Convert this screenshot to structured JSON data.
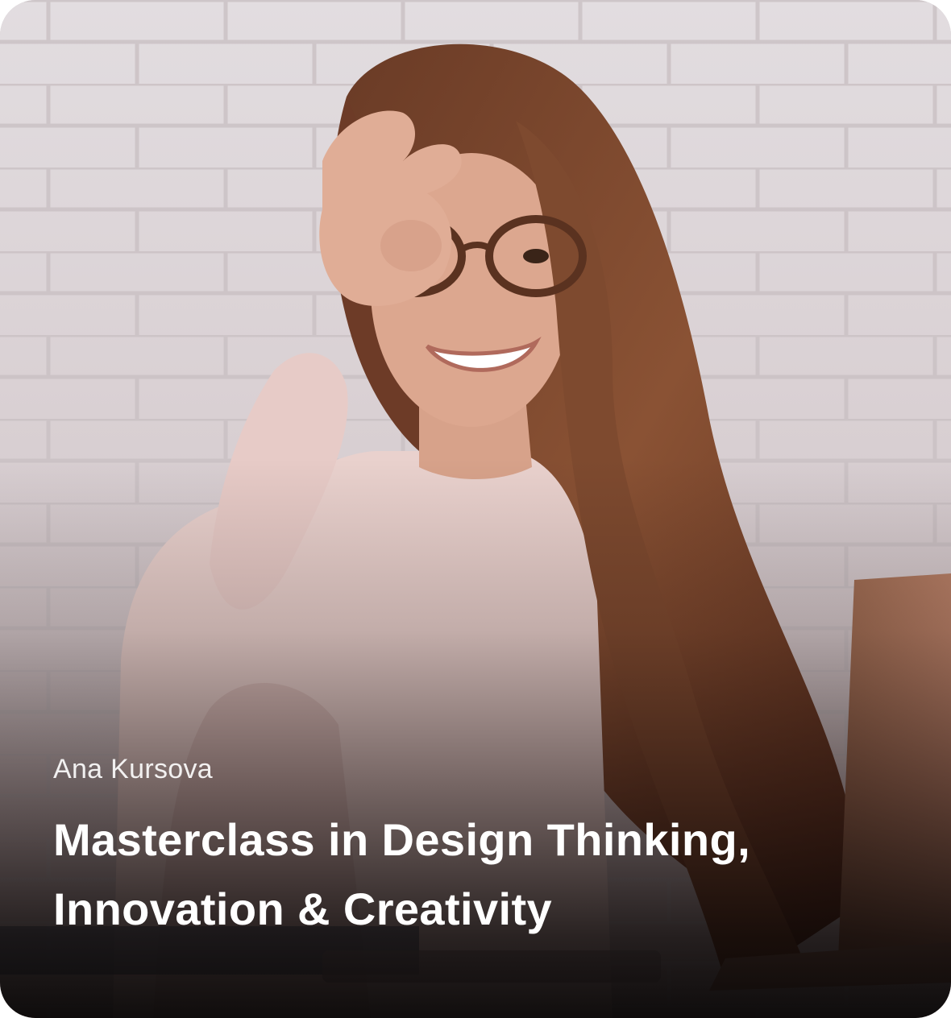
{
  "course_card": {
    "author": "Ana Kursova",
    "title_lines": [
      "Masterclass in Design Thinking,",
      "Innovation & Creativity"
    ]
  }
}
